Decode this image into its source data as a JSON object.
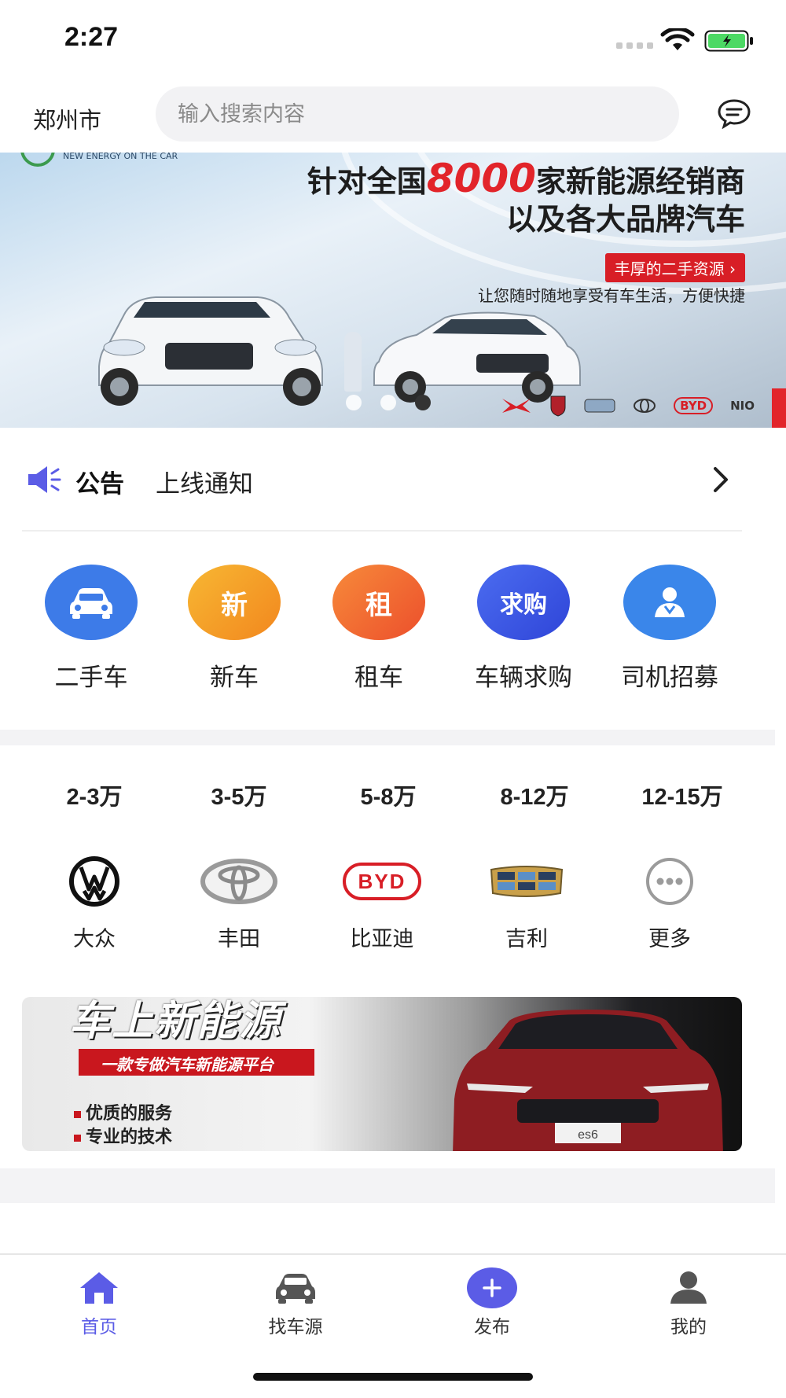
{
  "status_bar": {
    "time": "2:27"
  },
  "header": {
    "city": "郑州市",
    "search_placeholder": "输入搜索内容"
  },
  "banner": {
    "corner_text": "NEW ENERGY ON THE CAR",
    "line1_before": "针对全国",
    "line1_number": "8000",
    "line1_after": "家新能源经销商",
    "line2": "以及各大品牌汽车",
    "tag": "丰厚的二手资源 ›",
    "subtitle": "让您随时随地享受有车生活，方便快捷",
    "brand_strip": [
      "BYD",
      "NIO"
    ],
    "active_slide": 3,
    "slide_count": 3
  },
  "notice": {
    "label": "公告",
    "text": "上线通知"
  },
  "categories": [
    {
      "label": "二手车",
      "icon": "car-icon",
      "glyph": "",
      "color": "#3d7be8"
    },
    {
      "label": "新车",
      "icon": "new-badge",
      "glyph": "新",
      "color": "#f59a23"
    },
    {
      "label": "租车",
      "icon": "rent-badge",
      "glyph": "租",
      "color": "#f0652f"
    },
    {
      "label": "车辆求购",
      "icon": "buy-badge",
      "glyph": "求购",
      "color": "#3d55e0"
    },
    {
      "label": "司机招募",
      "icon": "driver-icon",
      "glyph": "",
      "color": "#3a86ea"
    }
  ],
  "price_ranges": [
    "2-3万",
    "3-5万",
    "5-8万",
    "8-12万",
    "12-15万"
  ],
  "brands": [
    {
      "name": "大众",
      "logo": "vw-logo"
    },
    {
      "name": "丰田",
      "logo": "toyota-logo"
    },
    {
      "name": "比亚迪",
      "logo": "byd-logo",
      "logo_text": "BYD"
    },
    {
      "name": "吉利",
      "logo": "geely-logo"
    },
    {
      "name": "更多",
      "logo": "more-icon"
    }
  ],
  "promo": {
    "title": "车上新能源",
    "slogan": "一款专做汽车新能源平台",
    "points": [
      "优质的服务",
      "专业的技术"
    ],
    "plate": "es6"
  },
  "tabbar": {
    "items": [
      {
        "label": "首页",
        "icon": "home-icon",
        "active": true
      },
      {
        "label": "找车源",
        "icon": "car-icon",
        "active": false
      },
      {
        "label": "发布",
        "icon": "plus-icon",
        "active": false
      },
      {
        "label": "我的",
        "icon": "user-icon",
        "active": false
      }
    ]
  },
  "colors": {
    "accent": "#5b5ce6",
    "banner_red": "#e2242a",
    "band_gray": "#f3f3f5"
  }
}
